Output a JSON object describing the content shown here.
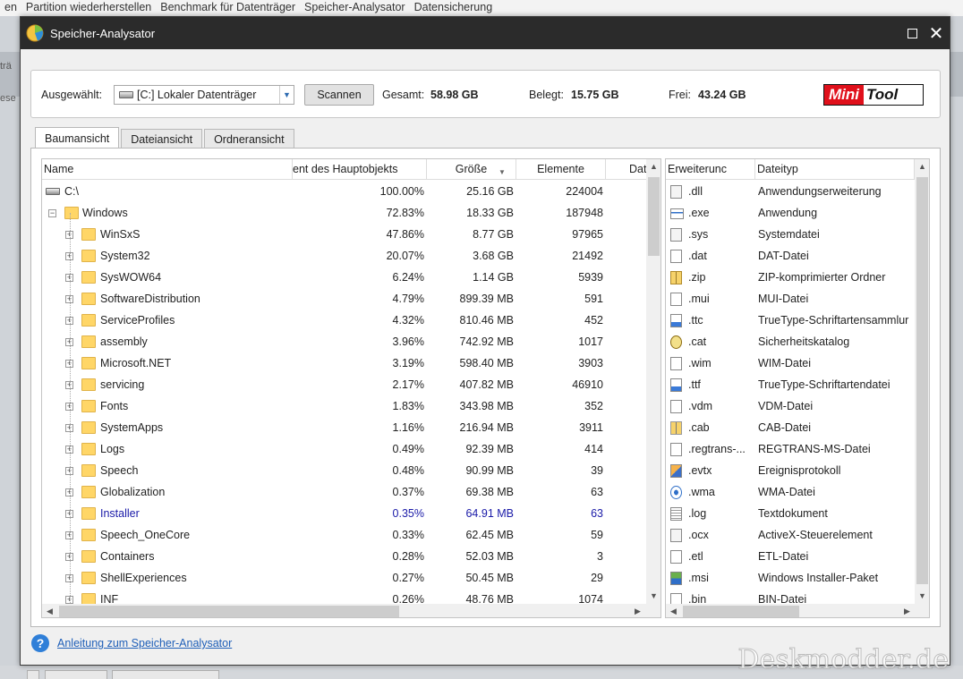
{
  "background_menu": [
    "en",
    "Partition wiederherstellen",
    "Benchmark für Datenträger",
    "Speicher-Analysator",
    "Datensicherung"
  ],
  "background_left_texts": [
    "trä",
    "ese"
  ],
  "watermark": "Deskmodder.de",
  "window": {
    "title": "Speicher-Analysator"
  },
  "toolbar": {
    "selected_label": "Ausgewählt:",
    "drive_value": "[C:] Lokaler Datenträger",
    "scan_label": "Scannen",
    "total_label": "Gesamt:",
    "total_value": "58.98 GB",
    "used_label": "Belegt:",
    "used_value": "15.75 GB",
    "free_label": "Frei:",
    "free_value": "43.24 GB",
    "logo_part1": "Mini",
    "logo_part2": "Tool"
  },
  "tabs": [
    "Baumansicht",
    "Dateiansicht",
    "Ordneransicht"
  ],
  "tree": {
    "columns": [
      "Name",
      "ent des Hauptobjekts",
      "Größe",
      "Elemente",
      "Dat"
    ],
    "rows": [
      {
        "name": "C:\\",
        "pct": "100.00%",
        "size": "25.16 GB",
        "items": "224004"
      },
      {
        "name": "Windows",
        "pct": "72.83%",
        "size": "18.33 GB",
        "items": "187948"
      },
      {
        "name": "WinSxS",
        "pct": "47.86%",
        "size": "8.77 GB",
        "items": "97965"
      },
      {
        "name": "System32",
        "pct": "20.07%",
        "size": "3.68 GB",
        "items": "21492"
      },
      {
        "name": "SysWOW64",
        "pct": "6.24%",
        "size": "1.14 GB",
        "items": "5939"
      },
      {
        "name": "SoftwareDistribution",
        "pct": "4.79%",
        "size": "899.39 MB",
        "items": "591"
      },
      {
        "name": "ServiceProfiles",
        "pct": "4.32%",
        "size": "810.46 MB",
        "items": "452"
      },
      {
        "name": "assembly",
        "pct": "3.96%",
        "size": "742.92 MB",
        "items": "1017"
      },
      {
        "name": "Microsoft.NET",
        "pct": "3.19%",
        "size": "598.40 MB",
        "items": "3903"
      },
      {
        "name": "servicing",
        "pct": "2.17%",
        "size": "407.82 MB",
        "items": "46910"
      },
      {
        "name": "Fonts",
        "pct": "1.83%",
        "size": "343.98 MB",
        "items": "352"
      },
      {
        "name": "SystemApps",
        "pct": "1.16%",
        "size": "216.94 MB",
        "items": "3911"
      },
      {
        "name": "Logs",
        "pct": "0.49%",
        "size": "92.39 MB",
        "items": "414"
      },
      {
        "name": "Speech",
        "pct": "0.48%",
        "size": "90.99 MB",
        "items": "39"
      },
      {
        "name": "Globalization",
        "pct": "0.37%",
        "size": "69.38 MB",
        "items": "63"
      },
      {
        "name": "Installer",
        "pct": "0.35%",
        "size": "64.91 MB",
        "items": "63"
      },
      {
        "name": "Speech_OneCore",
        "pct": "0.33%",
        "size": "62.45 MB",
        "items": "59"
      },
      {
        "name": "Containers",
        "pct": "0.28%",
        "size": "52.03 MB",
        "items": "3"
      },
      {
        "name": "ShellExperiences",
        "pct": "0.27%",
        "size": "50.45 MB",
        "items": "29"
      },
      {
        "name": "INF",
        "pct": "0.26%",
        "size": "48.76 MB",
        "items": "1074"
      }
    ]
  },
  "extensions": {
    "columns": [
      "Erweiterunc",
      "Dateityp"
    ],
    "rows": [
      {
        "ext": ".dll",
        "type": "Anwendungserweiterung",
        "icon": "dll-icon"
      },
      {
        "ext": ".exe",
        "type": "Anwendung",
        "icon": "exe-icon"
      },
      {
        "ext": ".sys",
        "type": "Systemdatei",
        "icon": "sys-icon"
      },
      {
        "ext": ".dat",
        "type": "DAT-Datei",
        "icon": "blank-file-icon"
      },
      {
        "ext": ".zip",
        "type": "ZIP-komprimierter Ordner",
        "icon": "zip-icon"
      },
      {
        "ext": ".mui",
        "type": "MUI-Datei",
        "icon": "blank-file-icon"
      },
      {
        "ext": ".ttc",
        "type": "TrueType-Schriftartensammlur",
        "icon": "font-icon"
      },
      {
        "ext": ".cat",
        "type": "Sicherheitskatalog",
        "icon": "catalog-icon"
      },
      {
        "ext": ".wim",
        "type": "WIM-Datei",
        "icon": "blank-file-icon"
      },
      {
        "ext": ".ttf",
        "type": "TrueType-Schriftartendatei",
        "icon": "font-icon"
      },
      {
        "ext": ".vdm",
        "type": "VDM-Datei",
        "icon": "blank-file-icon"
      },
      {
        "ext": ".cab",
        "type": "CAB-Datei",
        "icon": "cab-icon"
      },
      {
        "ext": ".regtrans-...",
        "type": "REGTRANS-MS-Datei",
        "icon": "blank-file-icon"
      },
      {
        "ext": ".evtx",
        "type": "Ereignisprotokoll",
        "icon": "event-log-icon"
      },
      {
        "ext": ".wma",
        "type": "WMA-Datei",
        "icon": "media-icon"
      },
      {
        "ext": ".log",
        "type": "Textdokument",
        "icon": "text-file-icon"
      },
      {
        "ext": ".ocx",
        "type": "ActiveX-Steuerelement",
        "icon": "dll-icon"
      },
      {
        "ext": ".etl",
        "type": "ETL-Datei",
        "icon": "blank-file-icon"
      },
      {
        "ext": ".msi",
        "type": "Windows Installer-Paket",
        "icon": "installer-icon"
      },
      {
        "ext": ".bin",
        "type": "BIN-Datei",
        "icon": "blank-file-icon"
      }
    ]
  },
  "footer": {
    "help_link": "Anleitung zum Speicher-Analysator"
  },
  "colors": {
    "selected_row_text": "#1a1aa8",
    "titlebar": "#2b2b2b",
    "logo_red": "#e0101b",
    "link": "#1f5fb8"
  }
}
